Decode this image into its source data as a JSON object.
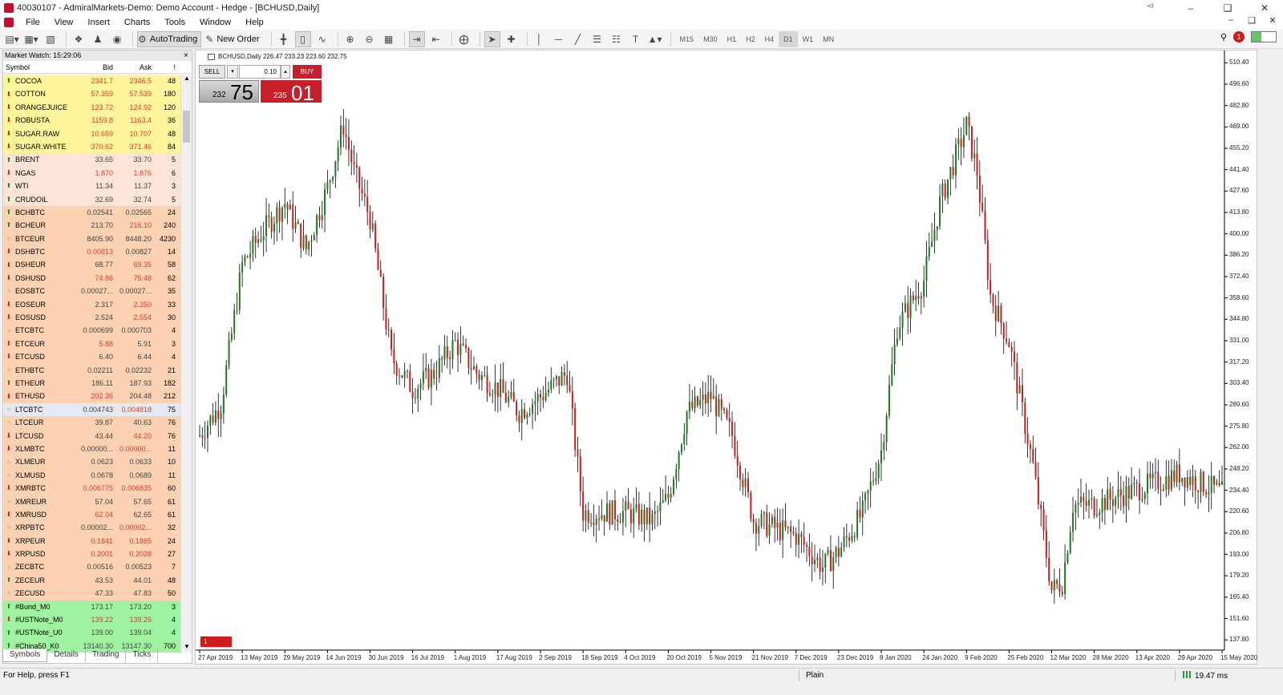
{
  "window": {
    "title": "40030107 - AdmiralMarkets-Demo: Demo Account - Hedge - [BCHUSD,Daily]",
    "controls": [
      "–",
      "❑",
      "✕"
    ],
    "mdi_controls": [
      "–",
      "❑",
      "✕"
    ]
  },
  "menu": [
    "File",
    "View",
    "Insert",
    "Charts",
    "Tools",
    "Window",
    "Help"
  ],
  "toolbar": {
    "autotrading_label": "AutoTrading",
    "new_order_label": "New Order",
    "timeframes": [
      "M15",
      "M30",
      "H1",
      "H2",
      "H4",
      "D1",
      "W1",
      "MN"
    ],
    "active_timeframe": "D1",
    "notification_count": "1"
  },
  "market_watch": {
    "title": "Market Watch: 15:29:06",
    "close": "×",
    "headers": {
      "symbol": "Symbol",
      "bid": "Bid",
      "ask": "Ask",
      "spread": "!"
    },
    "rows": [
      {
        "symbol": "COCOA",
        "bid": "2341.7",
        "ask": "2346.5",
        "spread": "48",
        "dir": "up",
        "bg": "#fff59a",
        "bidc": "down",
        "askc": "down"
      },
      {
        "symbol": "COTTON",
        "bid": "57.359",
        "ask": "57.539",
        "spread": "180",
        "dir": "down",
        "bg": "#fff59a",
        "bidc": "down",
        "askc": "down"
      },
      {
        "symbol": "ORANGEJUICE",
        "bid": "123.72",
        "ask": "124.92",
        "spread": "120",
        "dir": "down",
        "bg": "#fff59a",
        "bidc": "down",
        "askc": "down"
      },
      {
        "symbol": "ROBUSTA",
        "bid": "1159.8",
        "ask": "1163.4",
        "spread": "36",
        "dir": "down",
        "bg": "#fff59a",
        "bidc": "down",
        "askc": "down"
      },
      {
        "symbol": "SUGAR.RAW",
        "bid": "10.659",
        "ask": "10.707",
        "spread": "48",
        "dir": "down",
        "bg": "#fff59a",
        "bidc": "down",
        "askc": "down"
      },
      {
        "symbol": "SUGAR.WHITE",
        "bid": "370.62",
        "ask": "371.46",
        "spread": "84",
        "dir": "down",
        "bg": "#fff59a",
        "bidc": "down",
        "askc": "down"
      },
      {
        "symbol": "BRENT",
        "bid": "33.65",
        "ask": "33.70",
        "spread": "5",
        "dir": "up",
        "bg": "#fde4d6",
        "bidc": "up",
        "askc": "up"
      },
      {
        "symbol": "NGAS",
        "bid": "1.870",
        "ask": "1.876",
        "spread": "6",
        "dir": "down",
        "bg": "#fde4d6",
        "bidc": "down",
        "askc": "down"
      },
      {
        "symbol": "WTI",
        "bid": "11.34",
        "ask": "11.37",
        "spread": "3",
        "dir": "up",
        "bg": "#fde4d6",
        "bidc": "up",
        "askc": "up"
      },
      {
        "symbol": "CRUDOIL",
        "bid": "32.69",
        "ask": "32.74",
        "spread": "5",
        "dir": "up",
        "bg": "#fde4d6",
        "bidc": "up",
        "askc": "up"
      },
      {
        "symbol": "BCHBTC",
        "bid": "0.02541",
        "ask": "0.02565",
        "spread": "24",
        "dir": "up",
        "bg": "#fcd2b2",
        "bidc": "up",
        "askc": "up"
      },
      {
        "symbol": "BCHEUR",
        "bid": "213.70",
        "ask": "216.10",
        "spread": "240",
        "dir": "up",
        "bg": "#fcd2b2",
        "bidc": "up",
        "askc": "down"
      },
      {
        "symbol": "BTCEUR",
        "bid": "8405.90",
        "ask": "8448.20",
        "spread": "4230",
        "dir": "flat",
        "bg": "#fcd2b2",
        "bidc": "up",
        "askc": "up"
      },
      {
        "symbol": "DSHBTC",
        "bid": "0.00813",
        "ask": "0.00827",
        "spread": "14",
        "dir": "down",
        "bg": "#fcd2b2",
        "bidc": "down",
        "askc": "up"
      },
      {
        "symbol": "DSHEUR",
        "bid": "68.77",
        "ask": "69.35",
        "spread": "58",
        "dir": "down",
        "bg": "#fcd2b2",
        "bidc": "up",
        "askc": "down"
      },
      {
        "symbol": "DSHUSD",
        "bid": "74.86",
        "ask": "75.48",
        "spread": "62",
        "dir": "down",
        "bg": "#fcd2b2",
        "bidc": "down",
        "askc": "down"
      },
      {
        "symbol": "EOSBTC",
        "bid": "0.00027...",
        "ask": "0.00027...",
        "spread": "35",
        "dir": "flat",
        "bg": "#fcd2b2",
        "bidc": "up",
        "askc": "up"
      },
      {
        "symbol": "EOSEUR",
        "bid": "2.317",
        "ask": "2.350",
        "spread": "33",
        "dir": "down",
        "bg": "#fcd2b2",
        "bidc": "up",
        "askc": "down"
      },
      {
        "symbol": "EOSUSD",
        "bid": "2.524",
        "ask": "2.554",
        "spread": "30",
        "dir": "down",
        "bg": "#fcd2b2",
        "bidc": "up",
        "askc": "down"
      },
      {
        "symbol": "ETCBTC",
        "bid": "0.000699",
        "ask": "0.000703",
        "spread": "4",
        "dir": "flat",
        "bg": "#fcd2b2",
        "bidc": "up",
        "askc": "up"
      },
      {
        "symbol": "ETCEUR",
        "bid": "5.88",
        "ask": "5.91",
        "spread": "3",
        "dir": "down",
        "bg": "#fcd2b2",
        "bidc": "down",
        "askc": "up"
      },
      {
        "symbol": "ETCUSD",
        "bid": "6.40",
        "ask": "6.44",
        "spread": "4",
        "dir": "down",
        "bg": "#fcd2b2",
        "bidc": "up",
        "askc": "up"
      },
      {
        "symbol": "ETHBTC",
        "bid": "0.02211",
        "ask": "0.02232",
        "spread": "21",
        "dir": "flat",
        "bg": "#fcd2b2",
        "bidc": "up",
        "askc": "up"
      },
      {
        "symbol": "ETHEUR",
        "bid": "186.11",
        "ask": "187.93",
        "spread": "182",
        "dir": "up",
        "bg": "#fcd2b2",
        "bidc": "up",
        "askc": "up"
      },
      {
        "symbol": "ETHUSD",
        "bid": "202.36",
        "ask": "204.48",
        "spread": "212",
        "dir": "down",
        "bg": "#fcd2b2",
        "bidc": "down",
        "askc": "up"
      },
      {
        "symbol": "LTCBTC",
        "bid": "0.004743",
        "ask": "0.004818",
        "spread": "75",
        "dir": "flat",
        "bg": "#e4e9f4",
        "bidc": "up",
        "askc": "down"
      },
      {
        "symbol": "LTCEUR",
        "bid": "39.87",
        "ask": "40.63",
        "spread": "76",
        "dir": "flat",
        "bg": "#fcd2b2",
        "bidc": "up",
        "askc": "up"
      },
      {
        "symbol": "LTCUSD",
        "bid": "43.44",
        "ask": "44.20",
        "spread": "76",
        "dir": "down",
        "bg": "#fcd2b2",
        "bidc": "up",
        "askc": "down"
      },
      {
        "symbol": "XLMBTC",
        "bid": "0.00000...",
        "ask": "0.00000...",
        "spread": "11",
        "dir": "down",
        "bg": "#fcd2b2",
        "bidc": "up",
        "askc": "down"
      },
      {
        "symbol": "XLMEUR",
        "bid": "0.0623",
        "ask": "0.0633",
        "spread": "10",
        "dir": "flat",
        "bg": "#fcd2b2",
        "bidc": "up",
        "askc": "up"
      },
      {
        "symbol": "XLMUSD",
        "bid": "0.0678",
        "ask": "0.0689",
        "spread": "11",
        "dir": "flat",
        "bg": "#fcd2b2",
        "bidc": "up",
        "askc": "up"
      },
      {
        "symbol": "XMRBTC",
        "bid": "0.006775",
        "ask": "0.006835",
        "spread": "60",
        "dir": "down",
        "bg": "#fcd2b2",
        "bidc": "down",
        "askc": "down"
      },
      {
        "symbol": "XMREUR",
        "bid": "57.04",
        "ask": "57.65",
        "spread": "61",
        "dir": "flat",
        "bg": "#fcd2b2",
        "bidc": "up",
        "askc": "up"
      },
      {
        "symbol": "XMRUSD",
        "bid": "62.04",
        "ask": "62.65",
        "spread": "61",
        "dir": "down",
        "bg": "#fcd2b2",
        "bidc": "down",
        "askc": "up"
      },
      {
        "symbol": "XRPBTC",
        "bid": "0.00002...",
        "ask": "0.00002...",
        "spread": "32",
        "dir": "flat",
        "bg": "#fcd2b2",
        "bidc": "up",
        "askc": "down"
      },
      {
        "symbol": "XRPEUR",
        "bid": "0.1841",
        "ask": "0.1865",
        "spread": "24",
        "dir": "down",
        "bg": "#fcd2b2",
        "bidc": "down",
        "askc": "down"
      },
      {
        "symbol": "XRPUSD",
        "bid": "0.2001",
        "ask": "0.2028",
        "spread": "27",
        "dir": "down",
        "bg": "#fcd2b2",
        "bidc": "down",
        "askc": "down"
      },
      {
        "symbol": "ZECBTC",
        "bid": "0.00516",
        "ask": "0.00523",
        "spread": "7",
        "dir": "flat",
        "bg": "#fcd2b2",
        "bidc": "up",
        "askc": "up"
      },
      {
        "symbol": "ZECEUR",
        "bid": "43.53",
        "ask": "44.01",
        "spread": "48",
        "dir": "up",
        "bg": "#fcd2b2",
        "bidc": "up",
        "askc": "up"
      },
      {
        "symbol": "ZECUSD",
        "bid": "47.33",
        "ask": "47.83",
        "spread": "50",
        "dir": "flat",
        "bg": "#fcd2b2",
        "bidc": "up",
        "askc": "up"
      },
      {
        "symbol": "#Bund_M0",
        "bid": "173.17",
        "ask": "173.20",
        "spread": "3",
        "dir": "up",
        "bg": "#9ff29f",
        "bidc": "up",
        "askc": "up"
      },
      {
        "symbol": "#USTNote_M0",
        "bid": "139.22",
        "ask": "139.26",
        "spread": "4",
        "dir": "down",
        "bg": "#9ff29f",
        "bidc": "down",
        "askc": "down"
      },
      {
        "symbol": "#USTNote_U0",
        "bid": "139.00",
        "ask": "139.04",
        "spread": "4",
        "dir": "up",
        "bg": "#9ff29f",
        "bidc": "up",
        "askc": "up"
      },
      {
        "symbol": "#China50_K0",
        "bid": "13140.30",
        "ask": "13147.30",
        "spread": "700",
        "dir": "up",
        "bg": "#9ff29f",
        "bidc": "up",
        "askc": "up"
      }
    ],
    "tabs": [
      "Symbols",
      "Details",
      "Trading",
      "Ticks"
    ],
    "active_tab": "Symbols"
  },
  "chart": {
    "header": "BCHUSD,Daily  226.47 233.23 223.60 232.75",
    "one_click": {
      "sell_label": "SELL",
      "buy_label": "BUY",
      "lot": "0.10",
      "bid_small": "232",
      "bid_big": "75",
      "ask_small": "235",
      "ask_big": "01"
    },
    "marker_label": "1",
    "colors": {
      "bull": "#1f7a1f",
      "bear": "#d11a1a",
      "wick": "#000000"
    }
  },
  "chart_data": {
    "type": "candlestick",
    "symbol": "BCHUSD",
    "timeframe": "Daily",
    "ylim": [
      131.2,
      514.2
    ],
    "y_ticks": [
      "510.40",
      "496.60",
      "482.80",
      "469.00",
      "455.20",
      "441.40",
      "427.60",
      "413.80",
      "400.00",
      "386.20",
      "372.40",
      "358.60",
      "344.80",
      "331.00",
      "317.20",
      "303.40",
      "289.60",
      "275.80",
      "262.00",
      "248.20",
      "234.40",
      "220.60",
      "206.80",
      "193.00",
      "179.20",
      "165.40",
      "151.60",
      "137.80"
    ],
    "x_ticks": [
      "27 Apr 2019",
      "13 May 2019",
      "29 May 2019",
      "14 Jun 2019",
      "30 Jun 2019",
      "16 Jul 2019",
      "1 Aug 2019",
      "17 Aug 2019",
      "2 Sep 2019",
      "18 Sep 2019",
      "4 Oct 2019",
      "20 Oct 2019",
      "5 Nov 2019",
      "21 Nov 2019",
      "7 Dec 2019",
      "23 Dec 2019",
      "8 Jan 2020",
      "24 Jan 2020",
      "9 Feb 2020",
      "25 Feb 2020",
      "12 Mar 2020",
      "28 Mar 2020",
      "13 Apr 2020",
      "29 Apr 2020",
      "15 May 2020"
    ],
    "close_path": [
      {
        "date": "27 Apr 2019",
        "close": 270
      },
      {
        "date": "5 May 2019",
        "close": 290
      },
      {
        "date": "13 May 2019",
        "close": 380
      },
      {
        "date": "20 May 2019",
        "close": 400
      },
      {
        "date": "29 May 2019",
        "close": 420
      },
      {
        "date": "6 Jun 2019",
        "close": 390
      },
      {
        "date": "14 Jun 2019",
        "close": 430
      },
      {
        "date": "20 Jun 2019",
        "close": 470
      },
      {
        "date": "24 Jun 2019",
        "close": 440
      },
      {
        "date": "30 Jun 2019",
        "close": 410
      },
      {
        "date": "8 Jul 2019",
        "close": 320
      },
      {
        "date": "16 Jul 2019",
        "close": 300
      },
      {
        "date": "24 Jul 2019",
        "close": 310
      },
      {
        "date": "1 Aug 2019",
        "close": 330
      },
      {
        "date": "9 Aug 2019",
        "close": 310
      },
      {
        "date": "17 Aug 2019",
        "close": 300
      },
      {
        "date": "25 Aug 2019",
        "close": 285
      },
      {
        "date": "2 Sep 2019",
        "close": 295
      },
      {
        "date": "12 Sep 2019",
        "close": 310
      },
      {
        "date": "18 Sep 2019",
        "close": 220
      },
      {
        "date": "4 Oct 2019",
        "close": 220
      },
      {
        "date": "14 Oct 2019",
        "close": 215
      },
      {
        "date": "20 Oct 2019",
        "close": 230
      },
      {
        "date": "27 Oct 2019",
        "close": 285
      },
      {
        "date": "5 Nov 2019",
        "close": 295
      },
      {
        "date": "13 Nov 2019",
        "close": 270
      },
      {
        "date": "21 Nov 2019",
        "close": 215
      },
      {
        "date": "7 Dec 2019",
        "close": 205
      },
      {
        "date": "17 Dec 2019",
        "close": 185
      },
      {
        "date": "23 Dec 2019",
        "close": 195
      },
      {
        "date": "1 Jan 2020",
        "close": 220
      },
      {
        "date": "8 Jan 2020",
        "close": 260
      },
      {
        "date": "14 Jan 2020",
        "close": 340
      },
      {
        "date": "24 Jan 2020",
        "close": 370
      },
      {
        "date": "30 Jan 2020",
        "close": 420
      },
      {
        "date": "9 Feb 2020",
        "close": 470
      },
      {
        "date": "13 Feb 2020",
        "close": 440
      },
      {
        "date": "18 Feb 2020",
        "close": 360
      },
      {
        "date": "25 Feb 2020",
        "close": 330
      },
      {
        "date": "5 Mar 2020",
        "close": 250
      },
      {
        "date": "12 Mar 2020",
        "close": 170
      },
      {
        "date": "16 Mar 2020",
        "close": 175
      },
      {
        "date": "20 Mar 2020",
        "close": 225
      },
      {
        "date": "28 Mar 2020",
        "close": 225
      },
      {
        "date": "13 Apr 2020",
        "close": 235
      },
      {
        "date": "29 Apr 2020",
        "close": 245
      },
      {
        "date": "15 May 2020",
        "close": 232.75
      }
    ]
  },
  "status": {
    "help": "For Help, press F1",
    "profile": "Plain",
    "ping": "19.47 ms"
  }
}
